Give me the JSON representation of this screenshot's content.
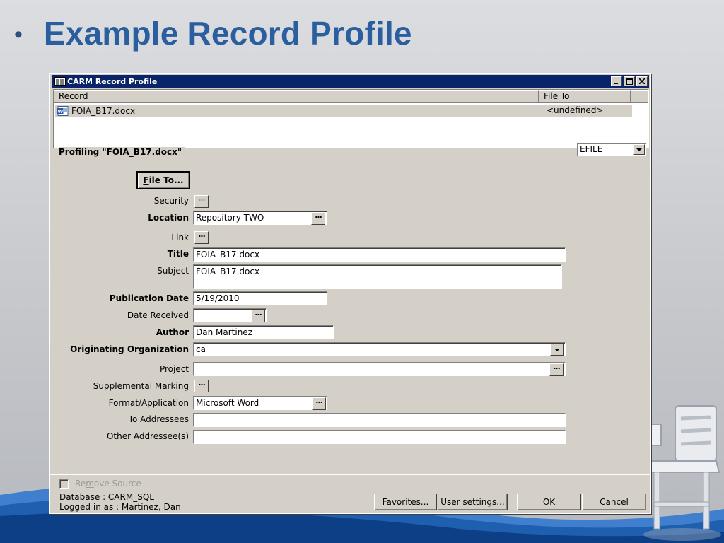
{
  "slide": {
    "bullet": "•",
    "title": "Example Record Profile"
  },
  "window": {
    "title": "CARM Record Profile",
    "controls": [
      "minimize",
      "maximize",
      "close"
    ]
  },
  "list": {
    "columns": [
      "Record",
      "File To"
    ],
    "rows": [
      {
        "record": "FOIA_B17.docx",
        "file_to": "<undefined>"
      }
    ]
  },
  "profiling": {
    "label": "Profiling \"FOIA_B17.docx\"",
    "form_type": "EFILE"
  },
  "file_to_button": {
    "underlined": "F",
    "rest": "ile To..."
  },
  "form": {
    "security": {
      "label": "Security"
    },
    "location": {
      "label": "Location",
      "value": "Repository TWO"
    },
    "link": {
      "label": "Link"
    },
    "title": {
      "label": "Title",
      "value": "FOIA_B17.docx"
    },
    "subject": {
      "label": "Subject",
      "value": "FOIA_B17.docx"
    },
    "publication_date": {
      "label": "Publication Date",
      "value": "5/19/2010"
    },
    "date_received": {
      "label": "Date Received",
      "value": ""
    },
    "author": {
      "label": "Author",
      "value": "Dan Martinez"
    },
    "originating_org": {
      "label": "Originating Organization",
      "value": "ca"
    },
    "project": {
      "label": "Project",
      "value": ""
    },
    "supplemental_marking": {
      "label": "Supplemental Marking"
    },
    "format_application": {
      "label": "Format/Application",
      "value": "Microsoft Word"
    },
    "to_addressees": {
      "label": "To Addressees",
      "value": ""
    },
    "other_addressees": {
      "label": "Other Addressee(s)",
      "value": ""
    }
  },
  "footer": {
    "remove_source": {
      "pre": "Re",
      "underlined": "m",
      "post": "ove Source",
      "checked": false,
      "disabled": true
    },
    "database": "Database : CARM_SQL",
    "logged_in": "Logged in as : Martinez, Dan",
    "buttons": {
      "favorites": {
        "pre": "Fa",
        "underlined": "v",
        "post": "orites..."
      },
      "user_settings": {
        "pre": "",
        "underlined": "U",
        "post": "ser settings..."
      },
      "ok": {
        "label": "OK"
      },
      "cancel": {
        "pre": "",
        "underlined": "C",
        "post": "ancel"
      }
    }
  },
  "colors": {
    "title_blue": "#2a5e9e",
    "titlebar": "#0a246a",
    "dialog_face": "#d4d0c8",
    "wave_blue": "#1f5fb0"
  }
}
